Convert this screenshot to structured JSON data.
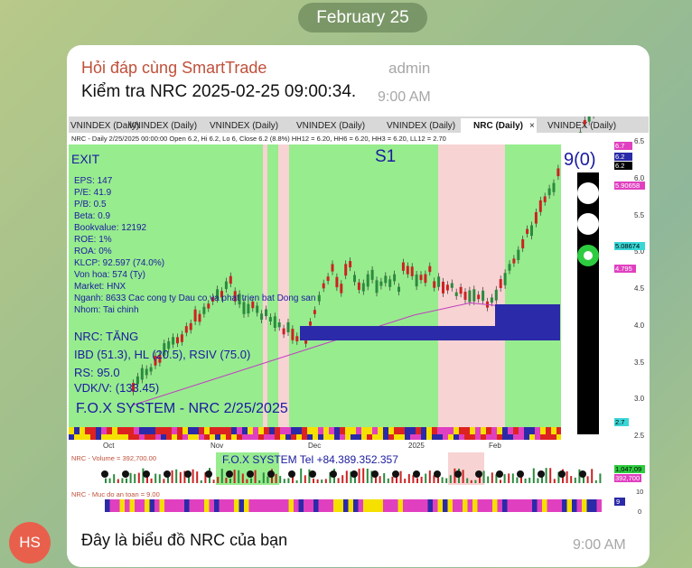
{
  "date_header": "February 25",
  "message1": {
    "sender": "Hỏi đáp cùng SmartTrade",
    "role": "admin",
    "text": "Kiểm tra NRC 2025-02-25 09:00:34.",
    "time": "9:00 AM"
  },
  "message2": {
    "avatar": "HS",
    "text": "Đây là biểu đồ NRC của bạn",
    "time": "9:00 AM"
  },
  "chart": {
    "tabs": [
      "VNINDEX (Daily)",
      "VNINDEX (Daily)",
      "VNINDEX (Daily)",
      "VNINDEX (Daily)",
      "VNINDEX (Daily)",
      "NRC (Daily)",
      "VNINDEX (Daily)"
    ],
    "active_tab": 5,
    "info_line": "NRC - Daily 2/25/2025 00:00:00 Open 6.2, Hi 6.2, Lo 6, Close 6.2 (8.8%) HH12 = 6.20, HH6 = 6.20, HH3 = 6.20, LL12 = 2.70",
    "exit_label": "EXIT",
    "s1_label": "S1",
    "signal_label": "9(0)",
    "fundamentals": [
      "EPS: 147",
      "P/E: 41.9",
      "P/B: 0.5",
      "Beta: 0.9",
      "Bookvalue: 12192",
      "ROE: 1%",
      "ROA: 0%",
      "KLCP: 92.597 (74.0%)",
      "Von hoa: 574 (Ty)",
      "Market: HNX",
      "Nganh: 8633 Cac cong ty Dau co va phat trien bat Dong san",
      "Nhom: Tai chinh"
    ],
    "status": "NRC: TĂNG",
    "rank_line": "IBD (51.3), HL (20.5), RSIV (75.0)",
    "rs_line": "RS: 95.0",
    "vdk_line": "VDK/V:  (133.45)",
    "fox_title": "F.O.X SYSTEM - NRC 2/25/2025",
    "price_axis": [
      "6.5",
      "6.0",
      "5.5",
      "5.0",
      "4.5",
      "4.0",
      "3.5",
      "3.0",
      "2.5"
    ],
    "price_tags": [
      "6.7",
      "6.2",
      "6.2",
      "5.90658",
      "5.08674",
      "4.795",
      "2.7"
    ],
    "x_labels": [
      "Oct",
      "Nov",
      "Dec",
      "2025",
      "Feb"
    ],
    "volume_header": "NRC - Volume = 392,700.00",
    "volume_tel": "F.O.X SYSTEM Tel +84.389.352.357",
    "volume_tags": [
      "1,047,09",
      "392,700"
    ],
    "safety_header": "NRC - Muc do an toan = 9.00",
    "safety_tags": [
      "9"
    ],
    "safety_axis": [
      "10",
      "0"
    ],
    "colors": {
      "uptrend": "#97ec8e",
      "downtrend": "#f7d3d3",
      "accent": "#c0503a",
      "bubble": "#ffffff"
    }
  }
}
